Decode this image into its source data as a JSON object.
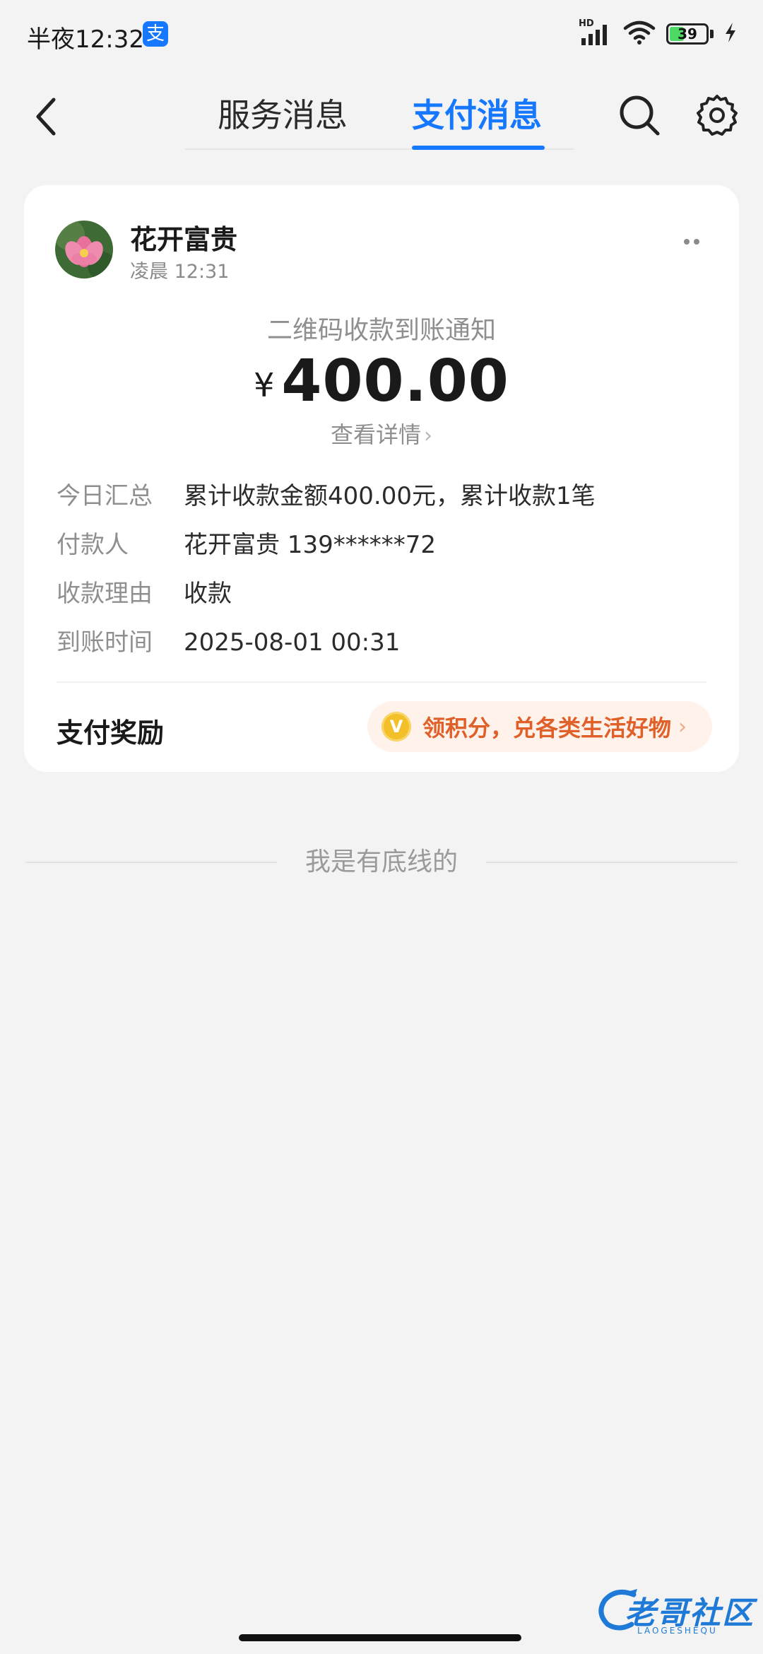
{
  "status_bar": {
    "time": "半夜12:32",
    "app_badge": "支",
    "network": "HD",
    "battery_level": "39",
    "battery_percent": 39,
    "icons": [
      "signal-icon",
      "wifi-icon",
      "battery-icon",
      "charging-icon"
    ]
  },
  "header": {
    "tabs": [
      {
        "label": "服务消息",
        "active": false
      },
      {
        "label": "支付消息",
        "active": true
      }
    ],
    "accent_color": "#1677ff",
    "icons": [
      "back-arrow-icon",
      "search-icon",
      "gear-icon"
    ]
  },
  "message": {
    "sender_name": "花开富贵",
    "time": "凌晨 12:31",
    "title": "二维码收款到账通知",
    "currency": "¥",
    "amount": "400.00",
    "detail_link": "查看详情",
    "rows": [
      {
        "label": "今日汇总",
        "value": "累计收款金额400.00元，累计收款1笔"
      },
      {
        "label": "付款人",
        "value": "花开富贵 139******72"
      },
      {
        "label": "收款理由",
        "value": "收款"
      },
      {
        "label": "到账时间",
        "value": "2025-08-01 00:31"
      }
    ],
    "reward_label": "支付奖励",
    "reward_badge": "V",
    "reward_text": "领积分，兑各类生活好物"
  },
  "footer": {
    "end_text": "我是有底线的"
  },
  "watermark": {
    "text": "老哥社区",
    "sub": "LAOGESHEQU"
  }
}
